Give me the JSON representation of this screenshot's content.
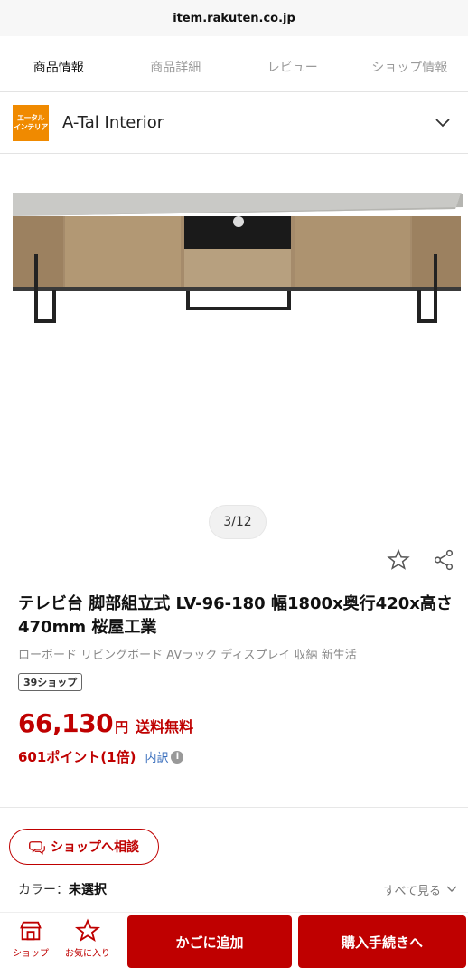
{
  "browser": {
    "url": "item.rakuten.co.jp"
  },
  "tabs": [
    {
      "label": "商品情報",
      "active": true
    },
    {
      "label": "商品詳細",
      "active": false
    },
    {
      "label": "レビュー",
      "active": false
    },
    {
      "label": "ショップ情報",
      "active": false
    }
  ],
  "shop": {
    "logo_line1": "エータル",
    "logo_line2": "インテリア",
    "name": "A-Tal Interior",
    "icon": "chevron-down-icon"
  },
  "gallery": {
    "counter": "3/12"
  },
  "product": {
    "title": "テレビ台 脚部組立式 LV-96-180 幅1800x奥行420x高さ470mm 桜屋工業",
    "subtitle": "ローボード リビングボード AVラック ディスプレイ 収納 新生活",
    "badge": "39ショップ",
    "price": "66,130",
    "yen": "円",
    "shipping": "送料無料",
    "points": "601ポイント(1倍)",
    "breakdown": "内訳",
    "info_glyph": "i"
  },
  "consult": {
    "label": "ショップへ相談"
  },
  "color": {
    "label": "カラー：",
    "value": "未選択",
    "see_all": "すべて見る"
  },
  "bottom": {
    "shop_label": "ショップ",
    "fav_label": "お気に入り",
    "cart_label": "かごに追加",
    "buy_label": "購入手続きへ"
  },
  "colors": {
    "brand": "#bf0000",
    "logo": "#f08a00"
  }
}
